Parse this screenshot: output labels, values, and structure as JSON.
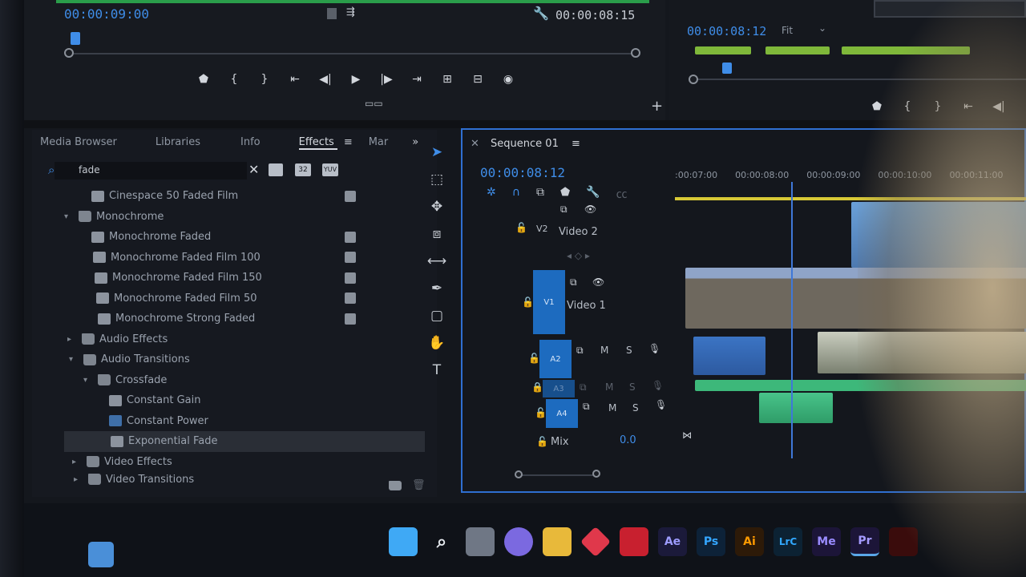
{
  "source_monitor": {
    "timecode_in": "00:00:09:00",
    "timecode_out": "00:00:08:15"
  },
  "program_monitor": {
    "timecode": "00:00:08:12",
    "fit_label": "Fit"
  },
  "effects_panel": {
    "tabs": [
      "Media Browser",
      "Libraries",
      "Info",
      "Effects",
      "Mar"
    ],
    "active_tab": "Effects",
    "search_value": "fade",
    "filter_badges": [
      "",
      "32",
      "YUV"
    ],
    "tree": [
      {
        "label": "Cinespace 50 Faded Film",
        "type": "preset",
        "indent": 1
      },
      {
        "label": "Monochrome",
        "type": "folder",
        "indent": 0
      },
      {
        "label": "Monochrome Faded",
        "type": "preset",
        "indent": 1
      },
      {
        "label": "Monochrome Faded Film 100",
        "type": "preset",
        "indent": 1
      },
      {
        "label": "Monochrome Faded Film 150",
        "type": "preset",
        "indent": 1
      },
      {
        "label": "Monochrome Faded Film 50",
        "type": "preset",
        "indent": 1
      },
      {
        "label": "Monochrome Strong Faded",
        "type": "preset",
        "indent": 1
      },
      {
        "label": "Audio Effects",
        "type": "folder",
        "indent": 0
      },
      {
        "label": "Audio Transitions",
        "type": "folder",
        "indent": 0
      },
      {
        "label": "Crossfade",
        "type": "folder",
        "indent": 1
      },
      {
        "label": "Constant Gain",
        "type": "effect",
        "indent": 2
      },
      {
        "label": "Constant Power",
        "type": "effect",
        "indent": 2
      },
      {
        "label": "Exponential Fade",
        "type": "effect",
        "indent": 2,
        "selected": true
      },
      {
        "label": "Video Effects",
        "type": "folder",
        "indent": 0
      },
      {
        "label": "Video Transitions",
        "type": "folder",
        "indent": 0
      }
    ]
  },
  "timeline": {
    "title": "Sequence 01",
    "timecode": "00:00:08:12",
    "ruler": [
      ":00:07:00",
      "00:00:08:00",
      "00:00:09:00",
      "00:00:10:00",
      "00:00:11:00"
    ],
    "tracks": {
      "v2": {
        "id": "V2",
        "name": "Video 2"
      },
      "v1": {
        "id": "V1",
        "name": "Video 1"
      },
      "a2": {
        "id": "A2",
        "m": "M",
        "s": "S"
      },
      "a3": {
        "id": "A3",
        "m": "M",
        "s": "S"
      },
      "a4": {
        "id": "A4",
        "m": "M",
        "s": "S"
      },
      "mix": {
        "name": "Mix",
        "value": "0.0"
      }
    }
  },
  "taskbar": {
    "apps": [
      {
        "name": "windows-start",
        "label": ""
      },
      {
        "name": "search",
        "label": ""
      },
      {
        "name": "task-view",
        "label": ""
      },
      {
        "name": "teams",
        "label": ""
      },
      {
        "name": "file-explorer",
        "label": ""
      },
      {
        "name": "app-red-diamond",
        "label": ""
      },
      {
        "name": "mcafee",
        "label": ""
      },
      {
        "name": "after-effects",
        "label": "Ae"
      },
      {
        "name": "photoshop",
        "label": "Ps"
      },
      {
        "name": "illustrator",
        "label": "Ai"
      },
      {
        "name": "lightroom-classic",
        "label": "LrC"
      },
      {
        "name": "media-encoder",
        "label": "Me"
      },
      {
        "name": "premiere-pro",
        "label": "Pr"
      },
      {
        "name": "acrobat",
        "label": ""
      }
    ]
  },
  "colors": {
    "accent_blue": "#3f8de8",
    "track_blue": "#1d6bbf",
    "timeline_border": "#2f6fd1",
    "audio_green": "#3db87a",
    "work_area_yellow": "#d8c936"
  }
}
